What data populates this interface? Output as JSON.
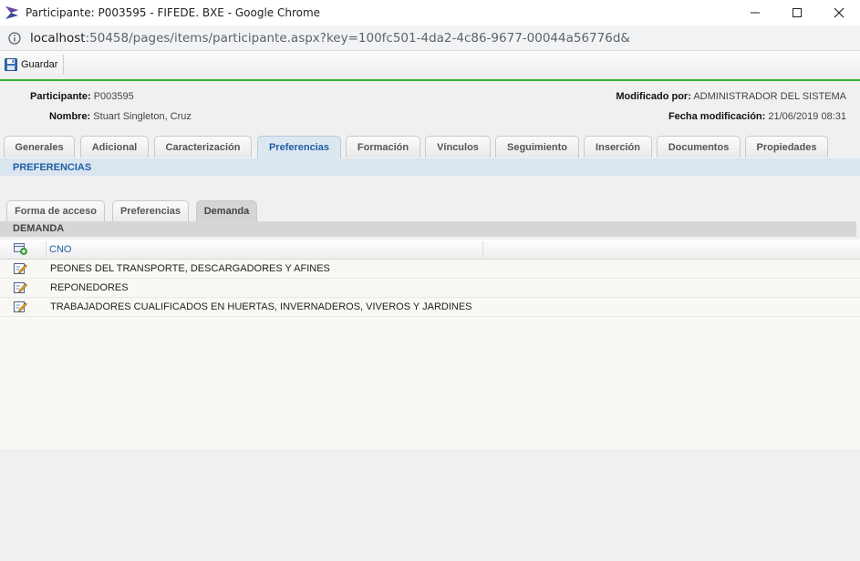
{
  "window": {
    "title": "Participante: P003595 - FIFEDE. BXE - Google Chrome",
    "url_host": "localhost",
    "url_path": ":50458/pages/items/participante.aspx?key=100fc501-4da2-4c86-9677-00044a56776d&"
  },
  "toolbar": {
    "save_label": "Guardar"
  },
  "header": {
    "participante_label": "Participante:",
    "participante_value": "P003595",
    "nombre_label": "Nombre:",
    "nombre_value": "Stuart Singleton, Cruz",
    "modificado_label": "Modificado por:",
    "modificado_value": "ADMINISTRADOR DEL SISTEMA",
    "fecha_label": "Fecha modificación:",
    "fecha_value": "21/06/2019 08:31"
  },
  "tabs": [
    {
      "label": "Generales"
    },
    {
      "label": "Adicional"
    },
    {
      "label": "Caracterización"
    },
    {
      "label": "Preferencias"
    },
    {
      "label": "Formación"
    },
    {
      "label": "Vínculos"
    },
    {
      "label": "Seguimiento"
    },
    {
      "label": "Inserción"
    },
    {
      "label": "Documentos"
    },
    {
      "label": "Propiedades"
    }
  ],
  "active_tab": "Preferencias",
  "section_title": "PREFERENCIAS",
  "subtabs": [
    {
      "label": "Forma de acceso"
    },
    {
      "label": "Preferencias"
    },
    {
      "label": "Demanda"
    }
  ],
  "active_subtab": "Demanda",
  "subsection_title": "DEMANDA",
  "grid": {
    "column": "CNO",
    "rows": [
      "PEONES DEL TRANSPORTE, DESCARGADORES Y AFINES",
      "REPONEDORES",
      "TRABAJADORES CUALIFICADOS EN HUERTAS, INVERNADEROS, VIVEROS Y JARDINES"
    ]
  },
  "colors": {
    "accent_green": "#2db52d",
    "link_blue": "#1f5fa3",
    "section_band": "#dbe5f0"
  }
}
